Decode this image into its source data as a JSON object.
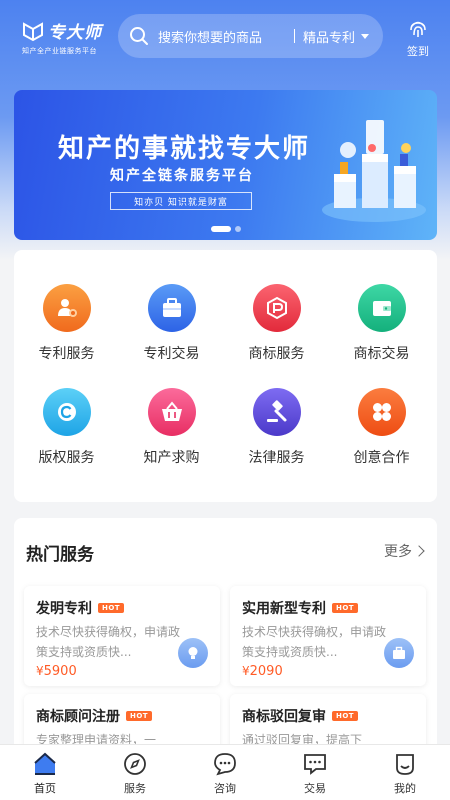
{
  "header": {
    "logo_title": "专大师",
    "logo_sub": "知产全产业链服务平台",
    "search_placeholder": "搜索你想要的商品",
    "search_category": "精品专利",
    "signin_label": "签到"
  },
  "banner": {
    "title": "知产的事就找专大师",
    "subtitle": "知产全链条服务平台",
    "tagline": "知亦贝  知识就是财富",
    "slides": 2,
    "active_slide": 1
  },
  "services": [
    {
      "label": "专利服务",
      "icon": "patent-service-icon",
      "color": "#f7852b"
    },
    {
      "label": "专利交易",
      "icon": "patent-trade-icon",
      "color": "#3e7cf0"
    },
    {
      "label": "商标服务",
      "icon": "trademark-service-icon",
      "color": "#ef3d4a"
    },
    {
      "label": "商标交易",
      "icon": "trademark-trade-icon",
      "color": "#22c18e"
    },
    {
      "label": "版权服务",
      "icon": "copyright-icon",
      "color": "#2fb4ee"
    },
    {
      "label": "知产求购",
      "icon": "basket-icon",
      "color": "#f0447a"
    },
    {
      "label": "法律服务",
      "icon": "gavel-icon",
      "color": "#5c4cdc"
    },
    {
      "label": "创意合作",
      "icon": "grid-icon",
      "color": "#f5632a"
    }
  ],
  "hot": {
    "title": "热门服务",
    "more": "更多",
    "badge": "HOT",
    "items": [
      {
        "name": "发明专利",
        "desc": "技术尽快获得确权，申请政策支持或资质快...",
        "price_symbol": "¥",
        "price": "5900",
        "icon": "bulb-icon"
      },
      {
        "name": "实用新型专利",
        "desc": "技术尽快获得确权，申请政策支持或资质快...",
        "price_symbol": "¥",
        "price": "2090",
        "icon": "briefcase-icon"
      },
      {
        "name": "商标顾问注册",
        "desc": "专家整理申请资料，一",
        "price_symbol": "",
        "price": "",
        "icon": ""
      },
      {
        "name": "商标驳回复审",
        "desc": "通过驳回复审，提高下",
        "price_symbol": "",
        "price": "",
        "icon": ""
      }
    ]
  },
  "tabs": [
    {
      "label": "首页",
      "icon": "home-icon",
      "active": true
    },
    {
      "label": "服务",
      "icon": "compass-icon",
      "active": false
    },
    {
      "label": "咨询",
      "icon": "chat-icon",
      "active": false
    },
    {
      "label": "交易",
      "icon": "message-icon",
      "active": false
    },
    {
      "label": "我的",
      "icon": "profile-icon",
      "active": false
    }
  ]
}
